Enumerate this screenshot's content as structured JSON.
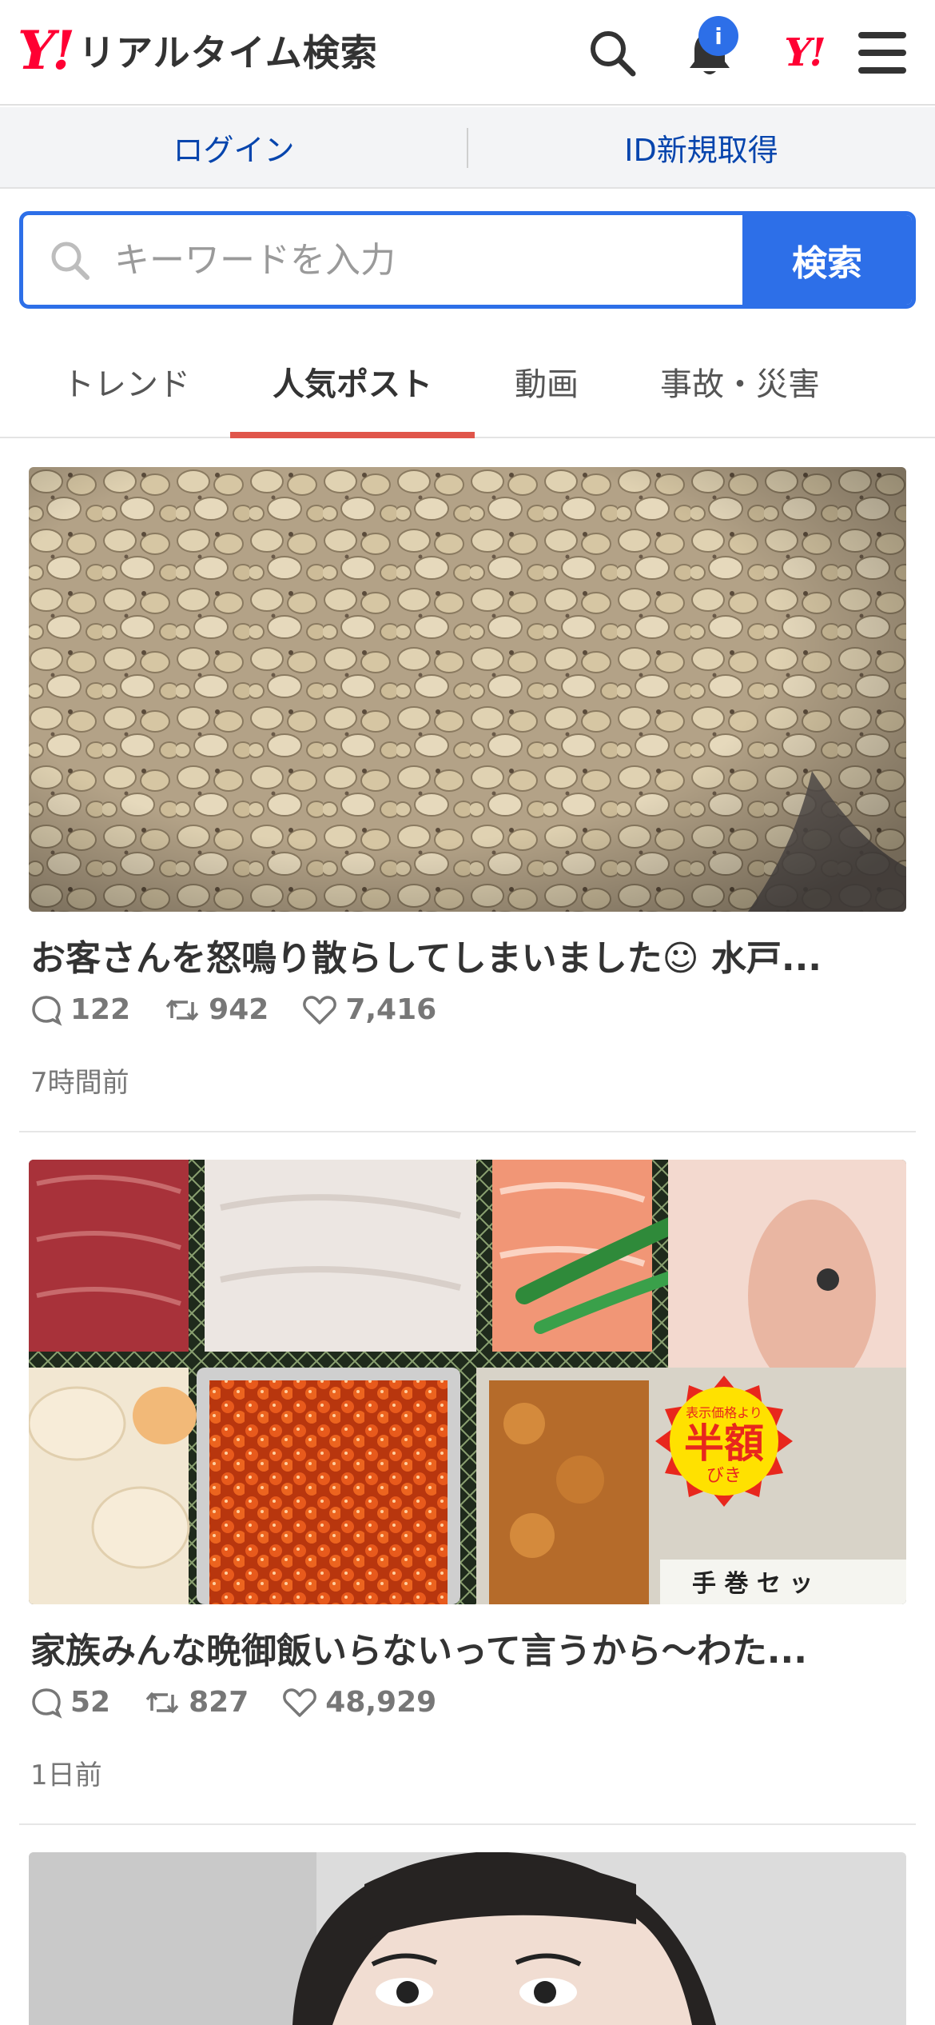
{
  "header": {
    "logo_mark": "Y!",
    "logo_text": "リアルタイム検索",
    "badge": "i",
    "yj_mark": "Y!"
  },
  "loginbar": {
    "login": "ログイン",
    "register": "ID新規取得"
  },
  "search": {
    "placeholder": "キーワードを入力",
    "button": "検索"
  },
  "tabs": [
    {
      "label": "トレンド"
    },
    {
      "label": "人気ポスト"
    },
    {
      "label": "動画"
    },
    {
      "label": "事故・災害"
    }
  ],
  "posts": [
    {
      "title": "お客さんを怒鳴り散らしてしまいました☺︎ 水戸...",
      "replies": "122",
      "reposts": "942",
      "likes": "7,416",
      "time": "7時間前",
      "image": "roasted-beans-photo"
    },
    {
      "title": "家族みんな晩御飯いらないって言うから〜わた...",
      "replies": "52",
      "reposts": "827",
      "likes": "48,929",
      "time": "1日前",
      "image": "sushi-pack-photo",
      "sticker_small": "表示価格より",
      "sticker_main": "半額",
      "sticker_sub": "びき",
      "label_text": "手 巻 セ ッ"
    },
    {
      "image": "person-photo"
    }
  ],
  "colors": {
    "accent": "#2d6fe8",
    "brand_red": "#ff0033",
    "tab_indicator": "#e0554a",
    "link": "#0645ad"
  }
}
